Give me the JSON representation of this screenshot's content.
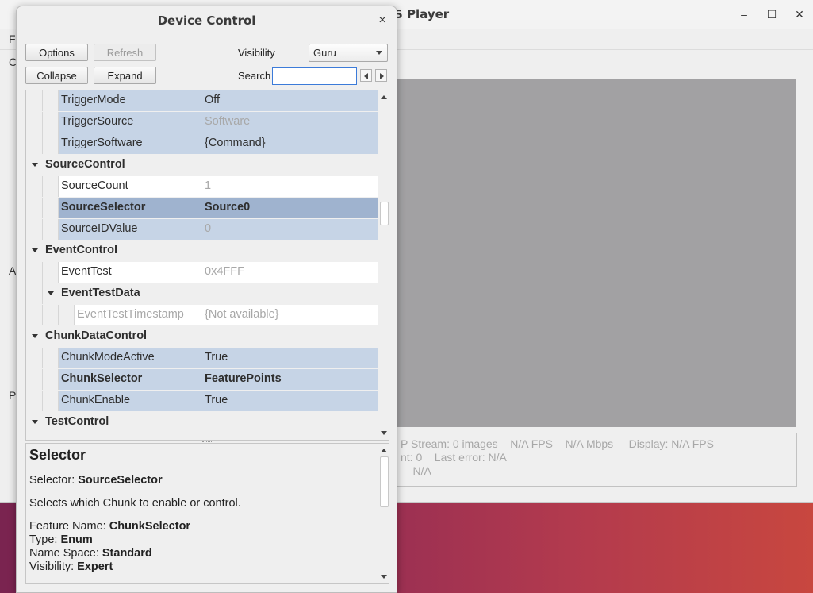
{
  "main_window": {
    "title": "S Player",
    "menu_partial": "F",
    "side_partial_c": "C",
    "side_partial_a": "A",
    "side_partial_p": "P",
    "status_line1": "P Stream: 0 images    N/A FPS    N/A Mbps     Display: N/A FPS",
    "status_line2": "nt: 0    Last error: N/A",
    "status_line3": "    N/A",
    "min_glyph": "–",
    "max_glyph": "☐",
    "close_glyph": "✕"
  },
  "dialog": {
    "title": "Device Control",
    "close_glyph": "×",
    "buttons": {
      "options": "Options",
      "refresh": "Refresh",
      "collapse": "Collapse",
      "expand": "Expand"
    },
    "visibility_label": "Visibility",
    "visibility_value": "Guru",
    "search_label": "Search",
    "search_value": "",
    "tree": [
      {
        "name": "TriggerMode",
        "value": "Off"
      },
      {
        "name": "TriggerSource",
        "value": "Software"
      },
      {
        "name": "TriggerSoftware",
        "value": "{Command}"
      },
      {
        "name": "SourceControl",
        "value": ""
      },
      {
        "name": "SourceCount",
        "value": "1"
      },
      {
        "name": "SourceSelector",
        "value": "Source0"
      },
      {
        "name": "SourceIDValue",
        "value": "0"
      },
      {
        "name": "EventControl",
        "value": ""
      },
      {
        "name": "EventTest",
        "value": "0x4FFF"
      },
      {
        "name": "EventTestData",
        "value": ""
      },
      {
        "name": "EventTestTimestamp",
        "value": "{Not available}"
      },
      {
        "name": "ChunkDataControl",
        "value": ""
      },
      {
        "name": "ChunkModeActive",
        "value": "True"
      },
      {
        "name": "ChunkSelector",
        "value": "FeaturePoints"
      },
      {
        "name": "ChunkEnable",
        "value": "True"
      },
      {
        "name": "TestControl",
        "value": ""
      }
    ],
    "description": {
      "title": "Selector",
      "selector_label": "Selector: ",
      "selector_value": "SourceSelector",
      "text": "Selects which Chunk to enable or control.",
      "feature_label": "Feature Name: ",
      "feature_value": "ChunkSelector",
      "type_label": "Type: ",
      "type_value": "Enum",
      "namespace_label": "Name Space: ",
      "namespace_value": "Standard",
      "visibility_label": "Visibility: ",
      "visibility_value": "Expert"
    }
  },
  "colors": {
    "row_highlight": "#c6d4e6",
    "row_selected": "#9fb3cf",
    "video_bg": "#a2a1a3",
    "desktop_left": "#7a2450",
    "desktop_right": "#c8473f"
  }
}
